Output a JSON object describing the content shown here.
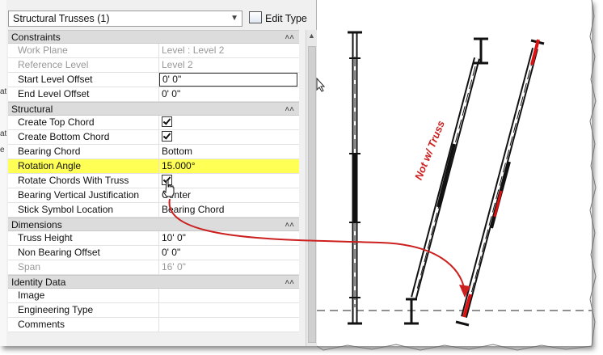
{
  "properties": {
    "type_selector": "Structural Trusses (1)",
    "edit_type_label": "Edit Type",
    "left_strip_chars": [
      "at",
      "at",
      "e"
    ],
    "categories": [
      {
        "name": "Constraints",
        "rows": [
          {
            "label": "Work Plane",
            "value": "Level : Level 2",
            "dim": true
          },
          {
            "label": "Reference Level",
            "value": "Level 2",
            "dim": true
          },
          {
            "label": "Start Level Offset",
            "value": "0'  0\"",
            "editing": true
          },
          {
            "label": "End Level Offset",
            "value": "0'  0\""
          }
        ]
      },
      {
        "name": "Structural",
        "rows": [
          {
            "label": "Create Top Chord",
            "checked": true
          },
          {
            "label": "Create Bottom Chord",
            "checked": true
          },
          {
            "label": "Bearing Chord",
            "value": "Bottom"
          },
          {
            "label": "Rotation Angle",
            "value": "15.000°",
            "highlight": true
          },
          {
            "label": "Rotate Chords With Truss",
            "checked": true
          },
          {
            "label": "Bearing Vertical Justification",
            "value": "Center"
          },
          {
            "label": "Stick Symbol Location",
            "value": "Bearing Chord"
          }
        ]
      },
      {
        "name": "Dimensions",
        "rows": [
          {
            "label": "Truss Height",
            "value": "10'  0\""
          },
          {
            "label": "Non Bearing Offset",
            "value": "0'  0\""
          },
          {
            "label": "Span",
            "value": "16'  0\"",
            "dim": true
          }
        ]
      },
      {
        "name": "Identity Data",
        "rows": [
          {
            "label": "Image",
            "value": ""
          },
          {
            "label": "Engineering Type",
            "value": ""
          },
          {
            "label": "Comments",
            "value": ""
          }
        ]
      }
    ]
  },
  "annotation": {
    "note_text": "Not w/ Truss",
    "note_color": "#cc1f1f",
    "highlight_color": "#ffff55"
  },
  "icons": [
    "dropdown-arrow-icon",
    "edit-type-icon",
    "collapse-icon",
    "checkbox-icon",
    "scroll-up-icon",
    "arrow-cursor-icon",
    "hand-cursor-icon"
  ]
}
